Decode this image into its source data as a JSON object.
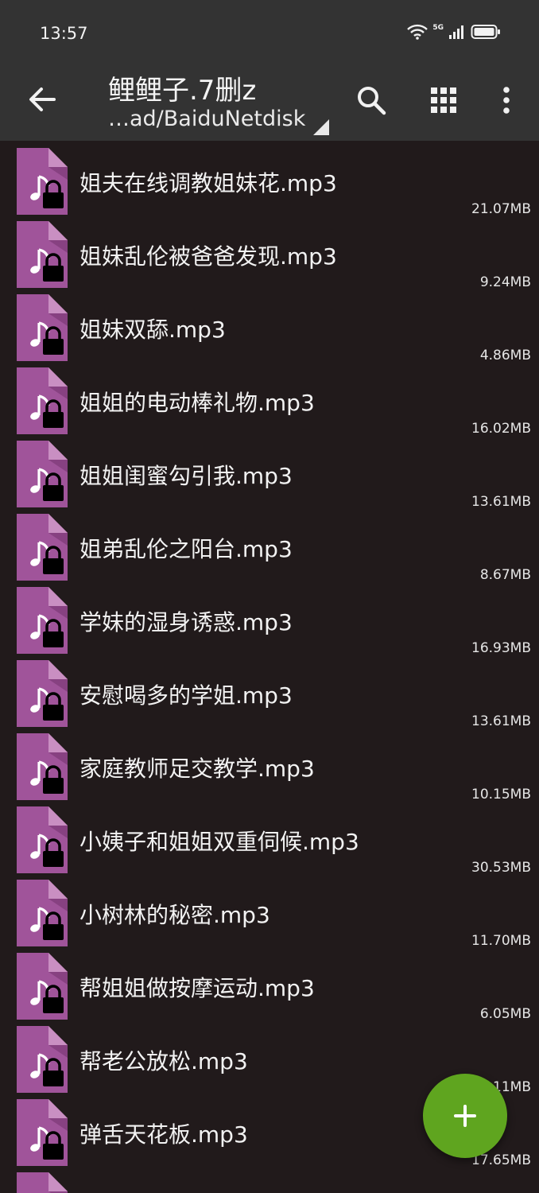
{
  "status_bar": {
    "time": "13:57",
    "network": "5G"
  },
  "toolbar": {
    "title": "鲤鲤子.7删z",
    "path": "…ad/BaiduNetdisk"
  },
  "files": [
    {
      "name": "姐夫在线调教姐妹花.mp3",
      "size": "21.07MB"
    },
    {
      "name": "姐妹乱伦被爸爸发现.mp3",
      "size": "9.24MB"
    },
    {
      "name": "姐妹双舔.mp3",
      "size": "4.86MB"
    },
    {
      "name": "姐姐的电动棒礼物.mp3",
      "size": "16.02MB"
    },
    {
      "name": "姐姐闺蜜勾引我.mp3",
      "size": "13.61MB"
    },
    {
      "name": "姐弟乱伦之阳台.mp3",
      "size": "8.67MB"
    },
    {
      "name": "学妹的湿身诱惑.mp3",
      "size": "16.93MB"
    },
    {
      "name": "安慰喝多的学姐.mp3",
      "size": "13.61MB"
    },
    {
      "name": "家庭教师足交教学.mp3",
      "size": "10.15MB"
    },
    {
      "name": "小姨子和姐姐双重伺候.mp3",
      "size": "30.53MB"
    },
    {
      "name": "小树林的秘密.mp3",
      "size": "11.70MB"
    },
    {
      "name": "帮姐姐做按摩运动.mp3",
      "size": "6.05MB"
    },
    {
      "name": "帮老公放松.mp3",
      "size": "…11MB"
    },
    {
      "name": "弹舌天花板.mp3",
      "size": "17.65MB"
    },
    {
      "name": "",
      "size": ""
    }
  ],
  "icons": {
    "file_type": "locked-audio-file-icon",
    "back": "arrow-left-icon",
    "search": "search-icon",
    "view": "grid-view-icon",
    "menu": "more-vert-icon",
    "fab": "plus-icon"
  },
  "colors": {
    "background": "#211a1b",
    "toolbar": "#333333",
    "file_icon": "#a0549a",
    "fab": "#5fa51f"
  }
}
